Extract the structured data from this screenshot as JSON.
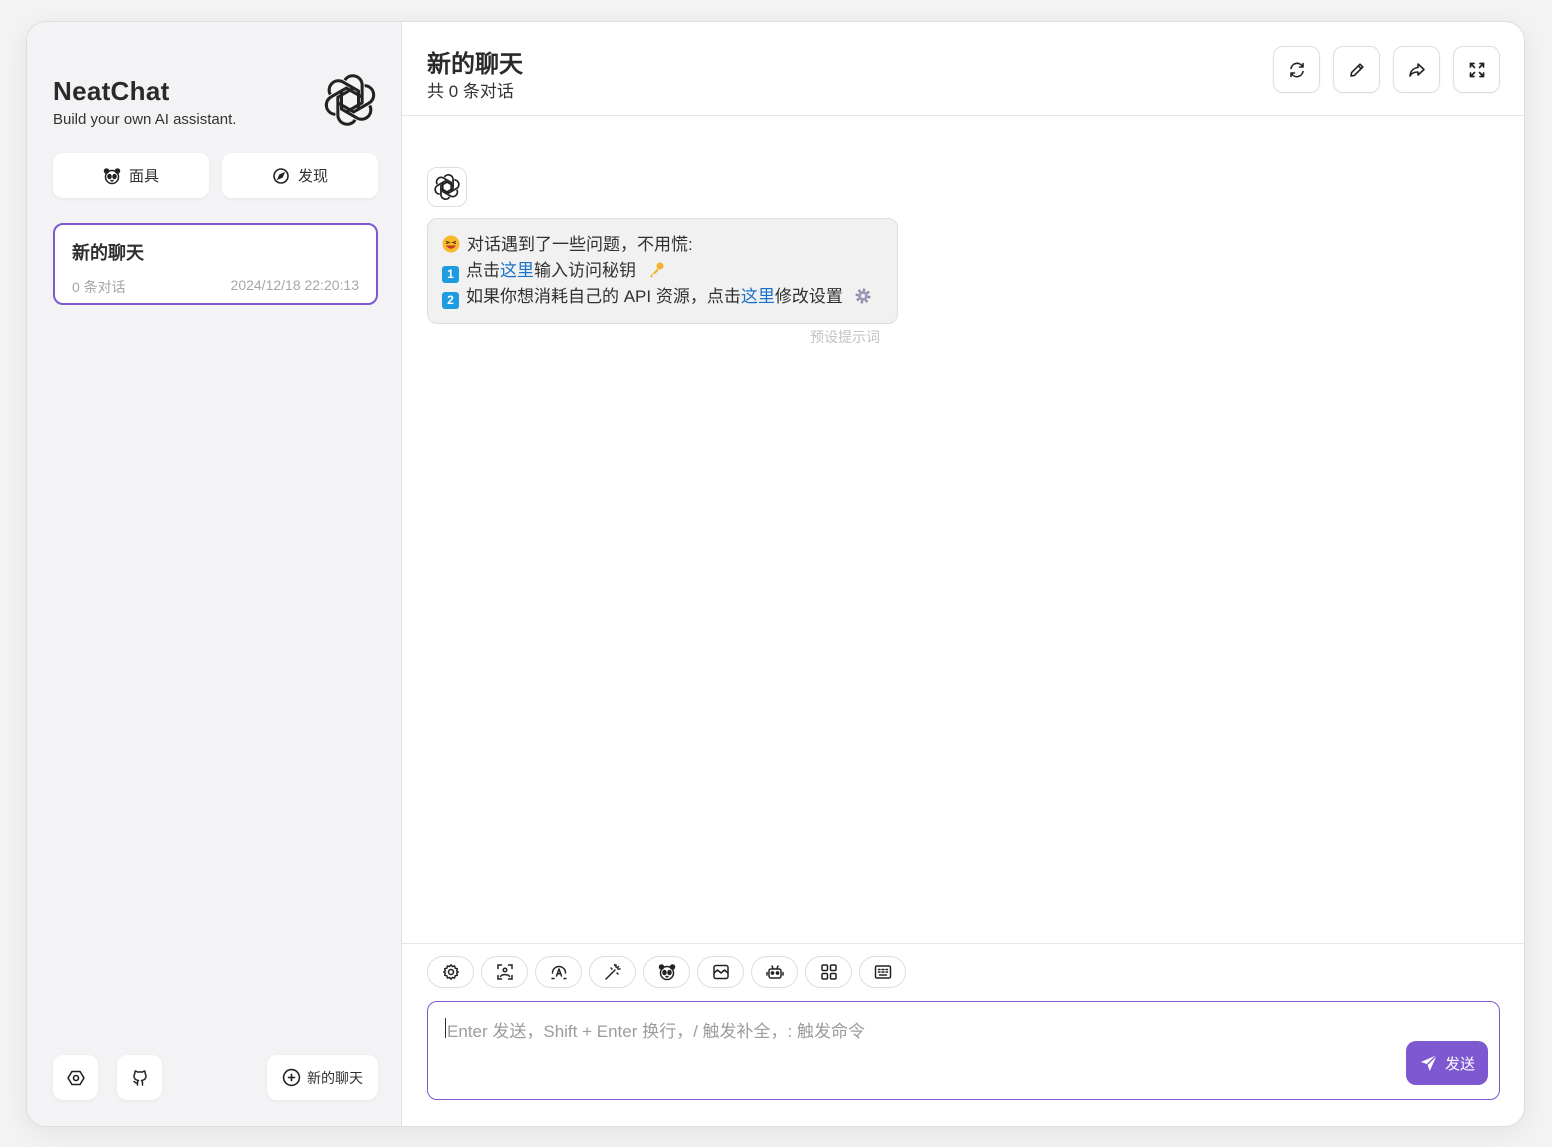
{
  "sidebar": {
    "brand_title": "NeatChat",
    "brand_subtitle": "Build your own AI assistant.",
    "mask_button": "面具",
    "discover_button": "发现",
    "chat_items": [
      {
        "title": "新的聊天",
        "count": "0 条对话",
        "time": "2024/12/18 22:20:13"
      }
    ],
    "new_chat_button": "新的聊天"
  },
  "header": {
    "title": "新的聊天",
    "subtitle": "共 0 条对话"
  },
  "message": {
    "line1": "对话遇到了一些问题，不用慌:",
    "line2_prefix": "点击",
    "line2_link": "这里",
    "line2_suffix": "输入访问秘钥",
    "line3_prefix": "如果你想消耗自己的 API 资源，点击",
    "line3_link": "这里",
    "line3_suffix": "修改设置",
    "badge1": "1",
    "badge2": "2",
    "date_label": "预设提示词"
  },
  "input": {
    "placeholder": "Enter 发送，Shift + Enter 换行，/ 触发补全，: 触发命令",
    "send_label": "发送"
  },
  "colors": {
    "accent": "#7d58d1",
    "link": "#1a73c8"
  }
}
